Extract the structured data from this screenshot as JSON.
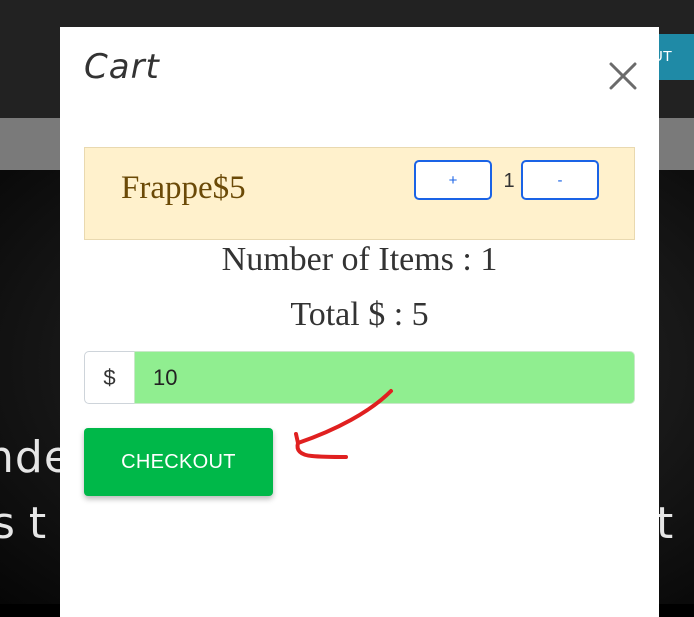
{
  "background": {
    "top_button_label": "UT",
    "hero_line_1": "nde",
    "hero_line_2_left": "s t",
    "hero_line_2_right": "t"
  },
  "modal": {
    "title": "Cart",
    "close_icon": "close-icon"
  },
  "cart": {
    "items": [
      {
        "name": "Frappe",
        "price": "$5",
        "label": "Frappe$5",
        "plus_label": "+",
        "quantity": "1",
        "minus_label": "-"
      }
    ]
  },
  "summary": {
    "count_text": "Number of Items : 1",
    "total_text": "Total $ : 5"
  },
  "payment": {
    "prefix": "$",
    "value": "10"
  },
  "checkout": {
    "label": "CHECKOUT"
  },
  "colors": {
    "cart_item_bg": "#fff1cc",
    "qty_border": "#1a63e6",
    "payment_input_bg": "#90ee90",
    "checkout_bg": "#00b849",
    "annotation_arrow": "#e02020"
  }
}
